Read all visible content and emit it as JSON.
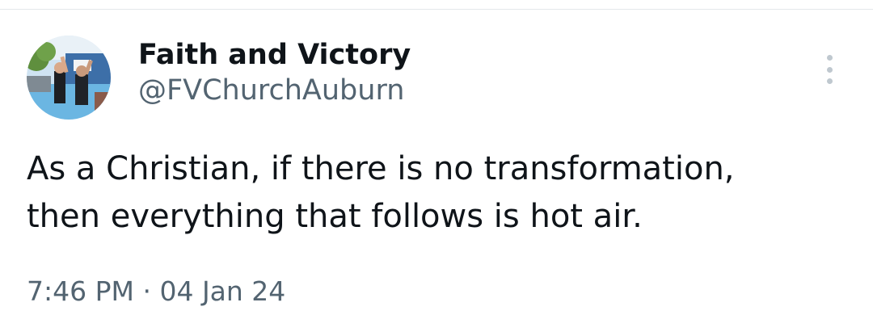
{
  "author": {
    "display_name": "Faith and Victory",
    "handle": "@FVChurchAuburn",
    "avatar_icon": "profile-photo-baptism"
  },
  "menu": {
    "icon": "more-vertical-icon"
  },
  "tweet": {
    "text_lines": [
      "As a Christian, if there is no transformation,",
      "then everything that follows is hot air."
    ]
  },
  "meta": {
    "time": "7:46 PM",
    "separator": "·",
    "date": "04 Jan 24"
  },
  "colors": {
    "text_primary": "#0f1419",
    "text_secondary": "#536471",
    "divider": "#e3e7ea",
    "icon_muted": "#bfc8cf"
  }
}
